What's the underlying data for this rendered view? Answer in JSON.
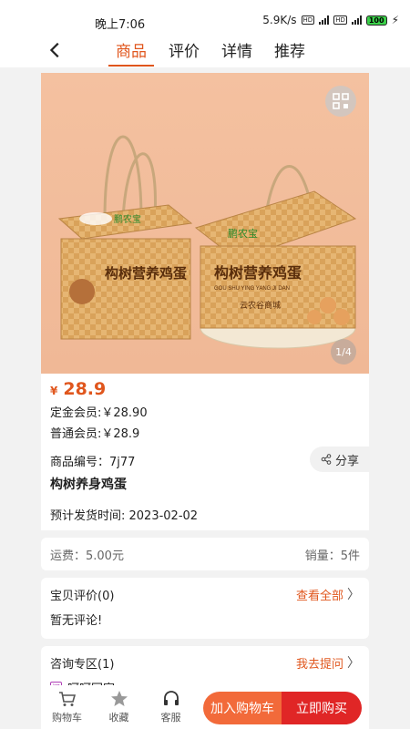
{
  "status": {
    "time": "晚上7:06",
    "speed": "5.9K/s",
    "battery": "100"
  },
  "nav": {
    "tabs": [
      {
        "label": "商品"
      },
      {
        "label": "评价"
      },
      {
        "label": "详情"
      },
      {
        "label": "推荐"
      }
    ]
  },
  "gallery": {
    "indicator": "1/4",
    "box_brand": "鹏农宝",
    "box_title": "构树营养鸡蛋",
    "box_pinyin": "GOU SHU YING YANG JI DAN",
    "box_sub": "云农谷商城"
  },
  "product": {
    "currency": "¥",
    "price": "28.9",
    "gold_member_price": "定金会员:￥28.90",
    "normal_member_price": "普通会员:￥28.9",
    "code": "商品编号：7j77",
    "title": "构树养身鸡蛋",
    "ship_date": "预计发货时间:   2023-02-02",
    "share_label": "分享"
  },
  "shipping": {
    "fee": "运费：5.00元",
    "sales": "销量：5件"
  },
  "reviews": {
    "title": "宝贝评价(0)",
    "link": "查看全部",
    "empty": "暂无评论!"
  },
  "qa": {
    "title": "咨询专区(1)",
    "link": "我去提问",
    "item": "呵呵回家"
  },
  "bottom": {
    "cart": "购物车",
    "favorite": "收藏",
    "service": "客服",
    "add_to_cart": "加入购物车",
    "buy_now": "立即购买"
  },
  "colors": {
    "accent": "#e0561d",
    "buy": "#e02626",
    "cart_btn": "#f26a3a"
  }
}
